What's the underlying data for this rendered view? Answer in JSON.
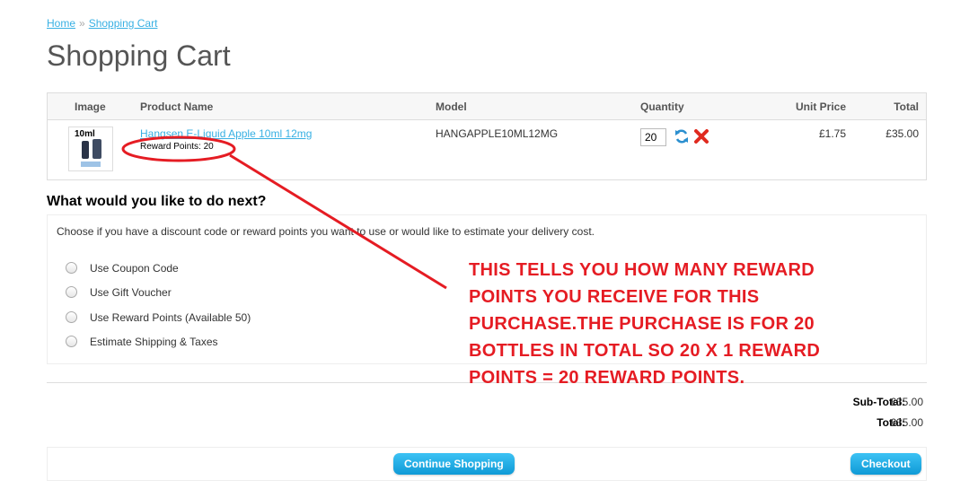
{
  "breadcrumb": {
    "items": [
      "Home",
      "Shopping Cart"
    ],
    "separator": "»"
  },
  "page": {
    "title": "Shopping Cart"
  },
  "cart": {
    "headers": {
      "image": "Image",
      "product": "Product Name",
      "model": "Model",
      "quantity": "Quantity",
      "unit_price": "Unit Price",
      "total": "Total"
    },
    "items": [
      {
        "thumb_label": "10ml",
        "name": "Hangsen E-Liquid Apple 10ml 12mg",
        "reward": "Reward Points: 20",
        "model": "HANGAPPLE10ML12MG",
        "quantity": "20",
        "unit_price": "£1.75",
        "total": "£35.00"
      }
    ]
  },
  "next": {
    "title": "What would you like to do next?",
    "intro": "Choose if you have a discount code or reward points you want to use or would like to estimate your delivery cost.",
    "options": [
      "Use Coupon Code",
      "Use Gift Voucher",
      "Use Reward Points (Available 50)",
      "Estimate Shipping & Taxes"
    ]
  },
  "totals": {
    "subtotal_label": "Sub-Total:",
    "subtotal": "£35.00",
    "total_label": "Total:",
    "total": "£35.00"
  },
  "buttons": {
    "continue": "Continue Shopping",
    "checkout": "Checkout"
  },
  "annotation": {
    "lines": [
      "THIS TELLS YOU HOW MANY REWARD",
      "POINTS YOU RECEIVE FOR THIS",
      "PURCHASE.THE PURCHASE IS FOR 20",
      "BOTTLES IN TOTAL SO 20 X 1 REWARD",
      "POINTS = 20 REWARD POINTS."
    ],
    "color": "#e51c23"
  },
  "colors": {
    "link": "#38b0e3",
    "button": "#1aa8e6"
  },
  "icons": {
    "update": "refresh-icon",
    "remove": "remove-x-icon"
  }
}
